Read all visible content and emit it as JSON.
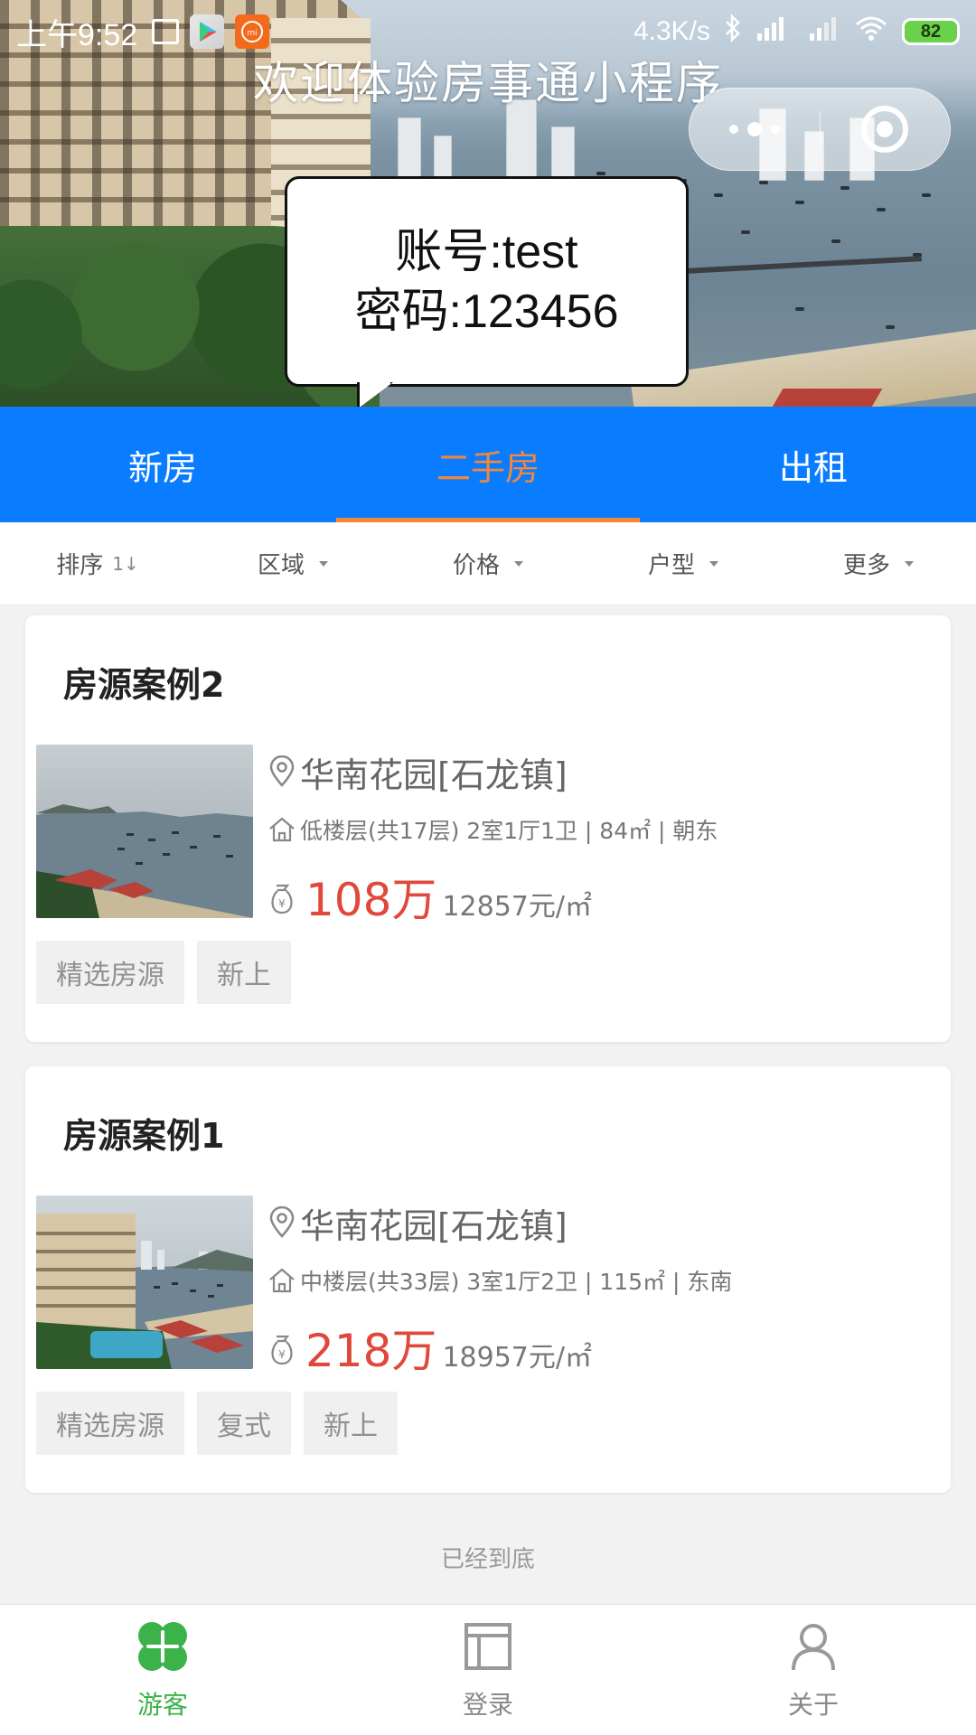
{
  "status_bar": {
    "time": "上午9:52",
    "network_speed": "4.3K/s",
    "battery": "82",
    "icons": [
      "notification-icon",
      "play-store-icon",
      "mi-icon",
      "bluetooth-icon",
      "signal-icon",
      "wifi-icon"
    ]
  },
  "hero": {
    "title": "欢迎体验房事通小程序",
    "callout_line1": "账号:test",
    "callout_line2": "密码:123456"
  },
  "tabs": [
    {
      "label": "新房",
      "active": false
    },
    {
      "label": "二手房",
      "active": true
    },
    {
      "label": "出租",
      "active": false
    }
  ],
  "filters": {
    "sort": "排序",
    "sort_icon": "1↓",
    "area": "区域",
    "price": "价格",
    "layout": "户型",
    "more": "更多"
  },
  "listings": [
    {
      "title": "房源案例2",
      "location": "华南花园[石龙镇]",
      "spec": "低楼层(共17层) 2室1厅1卫 | 84㎡ | 朝东",
      "price": "108万",
      "unit_price": "12857元/㎡",
      "tags": [
        "精选房源",
        "新上"
      ]
    },
    {
      "title": "房源案例1",
      "location": "华南花园[石龙镇]",
      "spec": "中楼层(共33层) 3室1厅2卫 | 115㎡ | 东南",
      "price": "218万",
      "unit_price": "18957元/㎡",
      "tags": [
        "精选房源",
        "复式",
        "新上"
      ]
    }
  ],
  "end_text": "已经到底",
  "bottom_nav": [
    {
      "label": "游客",
      "icon": "clover-icon",
      "active": true
    },
    {
      "label": "登录",
      "icon": "layout-icon",
      "active": false
    },
    {
      "label": "关于",
      "icon": "person-icon",
      "active": false
    }
  ],
  "colors": {
    "tab_bar": "#0a7cff",
    "active_tab": "#f3873c",
    "price": "#e0483b",
    "nav_active": "#3bb34a"
  }
}
